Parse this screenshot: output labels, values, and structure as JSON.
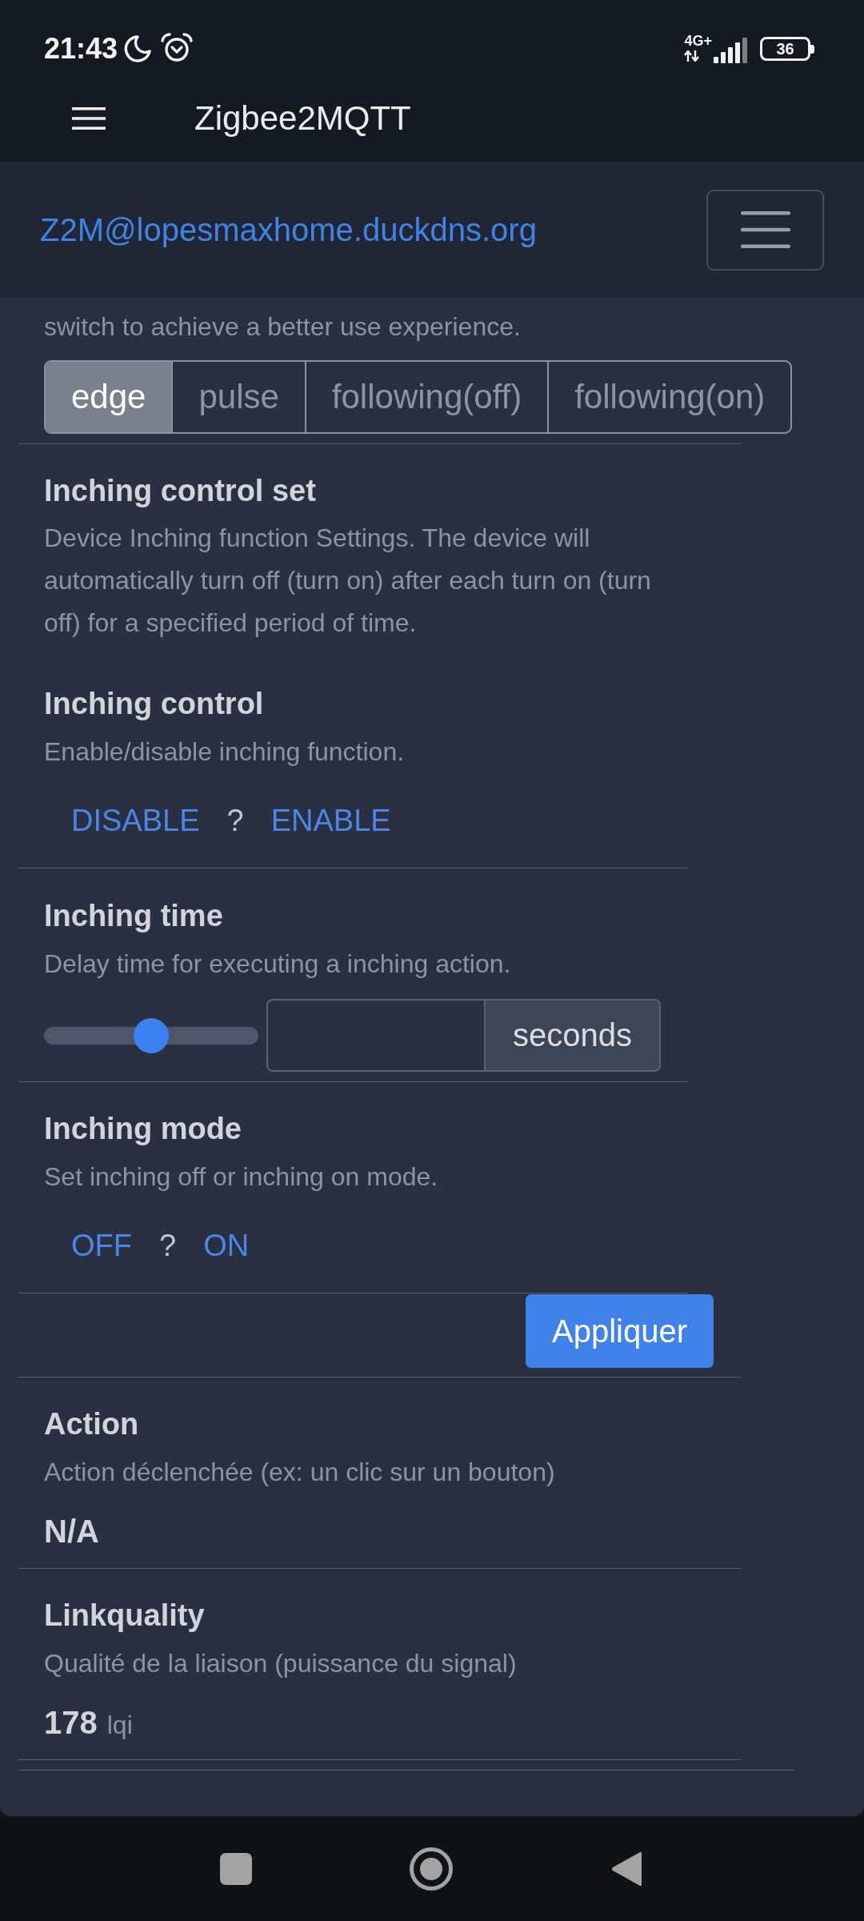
{
  "status_bar": {
    "time": "21:43",
    "network": "4G+",
    "battery": "36"
  },
  "app_bar": {
    "title": "Zigbee2MQTT"
  },
  "navbar": {
    "brand": "Z2M@lopesmaxhome.duckdns.org"
  },
  "features": [
    {
      "kind": "enum",
      "description": "switch to achieve a better use experience.",
      "options": [
        {
          "label": "edge",
          "selected": true
        },
        {
          "label": "pulse",
          "selected": false
        },
        {
          "label": "following(off)",
          "selected": false
        },
        {
          "label": "following(on)",
          "selected": false
        }
      ]
    },
    {
      "kind": "composite",
      "title": "Inching control set",
      "description": "Device Inching function Settings. The device will automatically turn off (turn on) after each turn on (turn off) for a specified period of time.",
      "items": [
        {
          "kind": "binary",
          "title": "Inching control",
          "description": "Enable/disable inching function.",
          "off_label": "DISABLE",
          "value": "?",
          "on_label": "ENABLE"
        },
        {
          "kind": "numeric",
          "title": "Inching time",
          "description": "Delay time for executing a inching action.",
          "level": 0.5,
          "unit": "seconds"
        },
        {
          "kind": "binary",
          "title": "Inching mode",
          "description": "Set inching off or inching on mode.",
          "off_label": "OFF",
          "value": "?",
          "on_label": "ON"
        }
      ],
      "apply_button": "Appliquer"
    },
    {
      "kind": "reading",
      "title": "Action",
      "description": "Action déclenchée (ex: un clic sur un bouton)",
      "value": "N/A"
    },
    {
      "kind": "reading",
      "title": "Linkquality",
      "description": "Qualité de la liaison (puissance du signal)",
      "value": "178",
      "unit": "lqi"
    }
  ]
}
